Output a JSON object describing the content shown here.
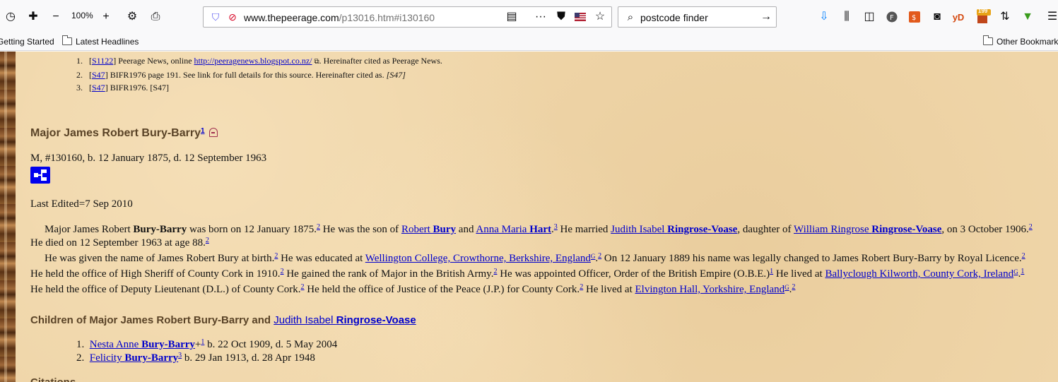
{
  "toolbar": {
    "zoom": "100%",
    "url_host": "www.thepeerage.com",
    "url_path": "/p13016.htm#i130160",
    "search_value": "postcode finder",
    "download_badge": "199",
    "yd_label": "yD"
  },
  "bookmarks": {
    "getting_started": "Getting Started",
    "latest_headlines": "Latest Headlines",
    "other": "Other Bookmarks"
  },
  "citations_top": [
    {
      "num": "1.",
      "src": "S1122",
      "text": " Peerage News, online ",
      "link": "http://peeragenews.blogspot.co.nz/",
      "after": ". Hereinafter cited as Peerage News."
    },
    {
      "num": "2.",
      "src": "S47",
      "text": " BIFR1976 page 191. See link for full details for this source. Hereinafter cited as. ",
      "italic": "[S47]"
    },
    {
      "num": "3.",
      "src": "S47",
      "text": " BIFR1976. [S47]"
    }
  ],
  "person": {
    "name": "Major James Robert Bury-Barry",
    "name_sup": "1",
    "summary": "M, #130160, b. 12 January 1875, d. 12 September 1963",
    "last_edited": "Last Edited=7 Sep 2010"
  },
  "bio": {
    "p1": {
      "a": "Major James Robert ",
      "b": "Bury-Barry",
      "c": " was born on 12 January 1875.",
      "c_sup": "2",
      "d": " He was the son of ",
      "father_first": "Robert ",
      "father_last": "Bury",
      "e": " and ",
      "mother_first": "Anna Maria ",
      "mother_last": "Hart",
      "f": ".",
      "f_sup": "3",
      "g": " He married ",
      "wife_first": "Judith Isabel ",
      "wife_last": "Ringrose-Voase",
      "h": ", daughter of ",
      "wfather_first": "William Ringrose ",
      "wfather_last": "Ringrose-Voase",
      "i": ", on 3 October 1906.",
      "i_sup": "2",
      "j": " He died on 12 September 1963 at age 88.",
      "j_sup": "2"
    },
    "p2": {
      "a": "He was given the name of James Robert Bury at birth.",
      "a_sup": "2",
      "b": " He was educated at ",
      "college": "Wellington College, Crowthorne, Berkshire, England",
      "g1": "G",
      "b_sup": "2",
      "c": " On 12 January 1889 his name was legally changed to James Robert Bury-Barry by Royal Licence.",
      "c_sup": "2",
      "d": " He held the office of High Sheriff of County Cork in 1910.",
      "d_sup": "2",
      "e": " He gained the rank of Major in the British Army.",
      "e_sup": "2",
      "f": " He was appointed Officer, Order of the British Empire (O.B.E.)",
      "f_sup": "1",
      "g": " He lived at ",
      "place1": "Ballyclough Kilworth, County Cork, Ireland",
      "g2": "G",
      "g_sup": "1",
      "h": " He held the office of Deputy Lieutenant (D.L.) of County Cork.",
      "h_sup": "2",
      "i": " He held the office of Justice of the Peace (J.P.) for County Cork.",
      "i_sup": "2",
      "j": " He lived at ",
      "place2": "Elvington Hall, Yorkshire, England",
      "g3": "G",
      "j_sup": "2"
    }
  },
  "children": {
    "heading": "Children of Major James Robert Bury-Barry and ",
    "spouse_first": "Judith Isabel ",
    "spouse_last": "Ringrose-Voase",
    "items": [
      {
        "num": "1.",
        "first": "Nesta Anne ",
        "last": "Bury-Barry",
        "plus": "+",
        "sup": "1",
        "text": " b. 22 Oct 1909, d. 5 May 2004"
      },
      {
        "num": "2.",
        "first": "Felicity ",
        "last": "Bury-Barry",
        "plus": "",
        "sup": "3",
        "text": " b. 29 Jan 1913, d. 28 Apr 1948"
      }
    ]
  },
  "next_section": "Citations"
}
